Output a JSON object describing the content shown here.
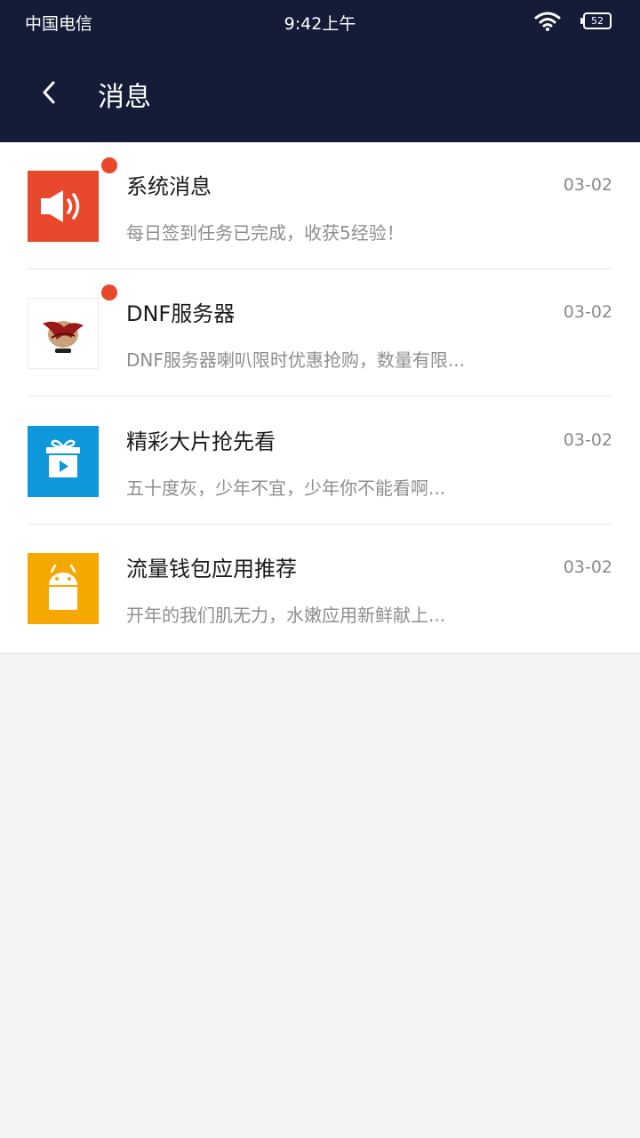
{
  "status_bar": {
    "carrier": "中国电信",
    "time": "9:42上午",
    "battery_level": "52"
  },
  "header": {
    "title": "消息"
  },
  "messages": [
    {
      "name": "系统消息",
      "date": "03-02",
      "preview": "每日签到任务已完成，收获5经验！",
      "unread": true,
      "icon": "speaker-icon",
      "color": "#e8492c"
    },
    {
      "name": "DNF服务器",
      "date": "03-02",
      "preview": "DNF服务器喇叭限时优惠抢购，数量有限...",
      "unread": true,
      "icon": "dnf-logo-icon",
      "color": "#ffffff"
    },
    {
      "name": "精彩大片抢先看",
      "date": "03-02",
      "preview": "五十度灰，少年不宜，少年你不能看啊...",
      "unread": false,
      "icon": "gift-video-icon",
      "color": "#0f97dc"
    },
    {
      "name": "流量钱包应用推荐",
      "date": "03-02",
      "preview": "开年的我们肌无力，水嫩应用新鲜献上...",
      "unread": false,
      "icon": "android-icon",
      "color": "#f5a800"
    }
  ]
}
